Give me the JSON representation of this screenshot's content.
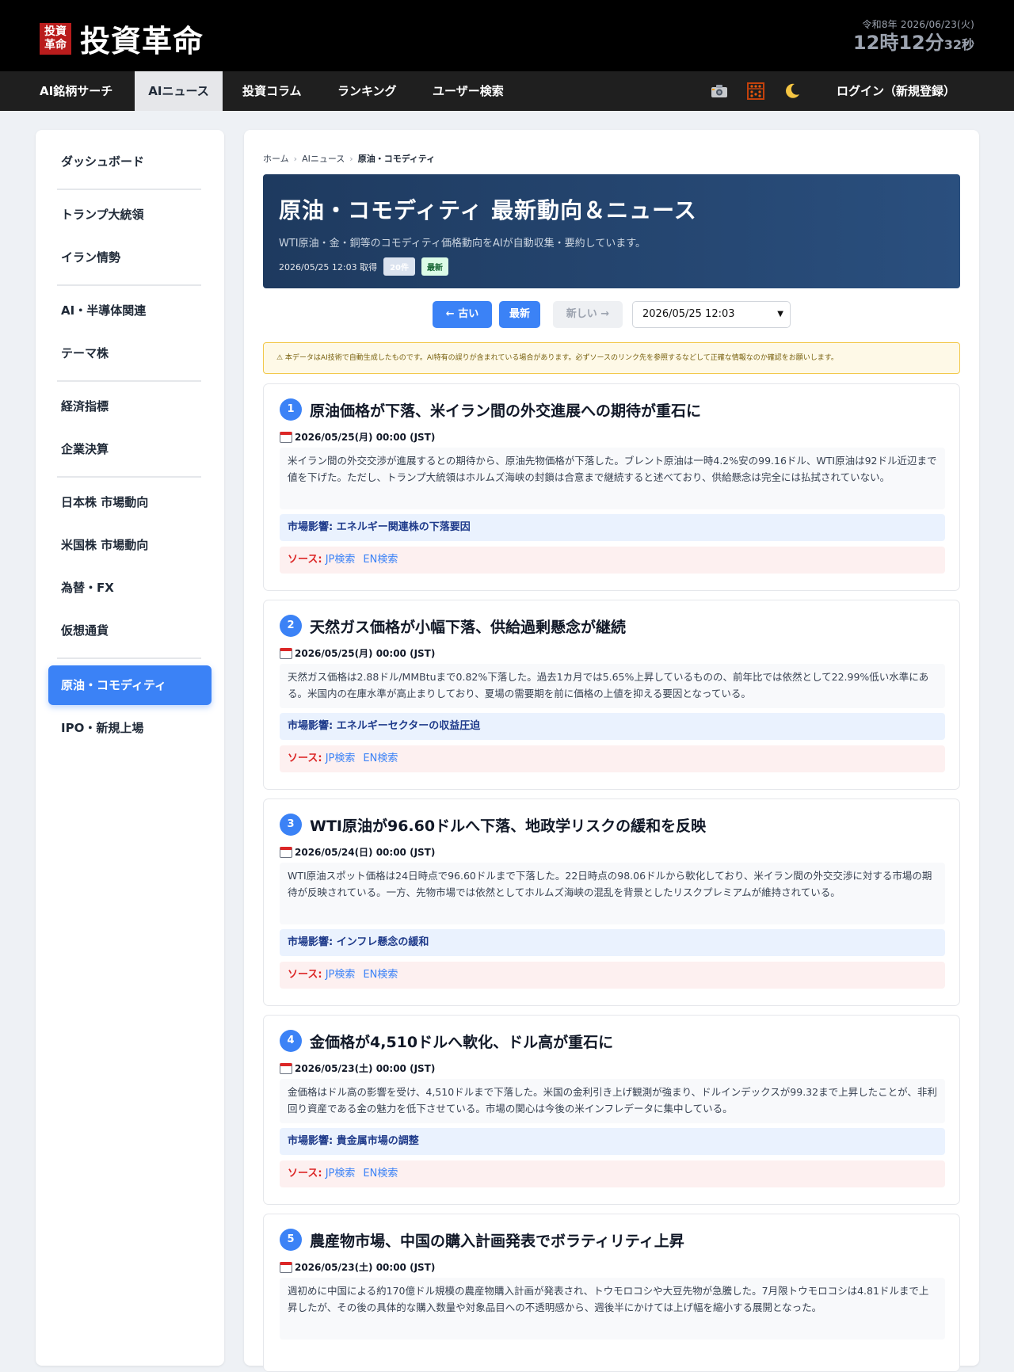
{
  "header": {
    "logo_box": "投資革命",
    "logo_text": "投資革命",
    "clock_date": "令和8年 2026/06/23(火)",
    "clock_time": "12時12分",
    "clock_sec": "32秒"
  },
  "nav": {
    "items": [
      "AI銘柄サーチ",
      "AIニュース",
      "投資コラム",
      "ランキング",
      "ユーザー検索"
    ],
    "active": "AIニュース",
    "icons": [
      "camera-icon",
      "abacus-icon",
      "moon-icon"
    ],
    "login": "ログイン（新規登録）"
  },
  "sidebar": {
    "items": [
      "ダッシュボード",
      "トランプ大統領",
      "イラン情勢",
      "AI・半導体関連",
      "テーマ株",
      "経済指標",
      "企業決算",
      "日本株 市場動向",
      "米国株 市場動向",
      "為替・FX",
      "仮想通貨",
      "原油・コモディティ",
      "IPO・新規上場"
    ],
    "active": "原油・コモディティ"
  },
  "breadcrumb": [
    "ホーム",
    "AIニュース",
    "原油・コモディティ"
  ],
  "hero": {
    "title": "原油・コモディティ 最新動向＆ニュース",
    "subtitle": "WTI原油・金・銅等のコモディティ価格動向をAIが自動収集・要約しています。",
    "fetched": "2026/05/25 12:03 取得",
    "count": "20件",
    "latest_badge": "最新"
  },
  "pager": {
    "older": "← 古い",
    "latest": "最新",
    "newer": "新しい →",
    "selected": "2026/05/25 12:03"
  },
  "notice": "⚠ 本データはAI技術で自動生成したものです。AI特有の誤りが含まれている場合があります。必ずソースのリンク先を参照するなどして正確な情報なのか確認をお願いします。",
  "labels": {
    "impact": "市場影響:",
    "source": "ソース:",
    "jp": "JP検索",
    "en": "EN検索"
  },
  "articles": [
    {
      "num": "1",
      "title": "原油価格が下落、米イラン間の外交進展への期待が重石に",
      "date": "2026/05/25(月) 00:00 (JST)",
      "body": "米イラン間の外交交渉が進展するとの期待から、原油先物価格が下落した。ブレント原油は一時4.2%安の99.16ドル、WTI原油は92ドル近辺まで値を下げた。ただし、トランプ大統領はホルムズ海峡の封鎖は合意まで継続すると述べており、供給懸念は完全には払拭されていない。",
      "impact": "エネルギー関連株の下落要因"
    },
    {
      "num": "2",
      "title": "天然ガス価格が小幅下落、供給過剰懸念が継続",
      "date": "2026/05/25(月) 00:00 (JST)",
      "body": "天然ガス価格は2.88ドル/MMBtuまで0.82%下落した。過去1カ月では5.65%上昇しているものの、前年比では依然として22.99%低い水準にある。米国内の在庫水準が高止まりしており、夏場の需要期を前に価格の上値を抑える要因となっている。",
      "impact": "エネルギーセクターの収益圧迫"
    },
    {
      "num": "3",
      "title": "WTI原油が96.60ドルへ下落、地政学リスクの緩和を反映",
      "date": "2026/05/24(日) 00:00 (JST)",
      "body": "WTI原油スポット価格は24日時点で96.60ドルまで下落した。22日時点の98.06ドルから軟化しており、米イラン間の外交交渉に対する市場の期待が反映されている。一方、先物市場では依然としてホルムズ海峡の混乱を背景としたリスクプレミアムが維持されている。",
      "impact": "インフレ懸念の緩和"
    },
    {
      "num": "4",
      "title": "金価格が4,510ドルへ軟化、ドル高が重石に",
      "date": "2026/05/23(土) 00:00 (JST)",
      "body": "金価格はドル高の影響を受け、4,510ドルまで下落した。米国の金利引き上げ観測が強まり、ドルインデックスが99.32まで上昇したことが、非利回り資産である金の魅力を低下させている。市場の関心は今後の米インフレデータに集中している。",
      "impact": "貴金属市場の調整"
    },
    {
      "num": "5",
      "title": "農産物市場、中国の購入計画発表でボラティリティ上昇",
      "date": "2026/05/23(土) 00:00 (JST)",
      "body": "週初めに中国による約170億ドル規模の農産物購入計画が発表され、トウモロコシや大豆先物が急騰した。7月限トウモロコシは4.81ドルまで上昇したが、その後の具体的な購入数量や対象品目への不透明感から、週後半にかけては上げ幅を縮小する展開となった。",
      "impact": ""
    }
  ]
}
